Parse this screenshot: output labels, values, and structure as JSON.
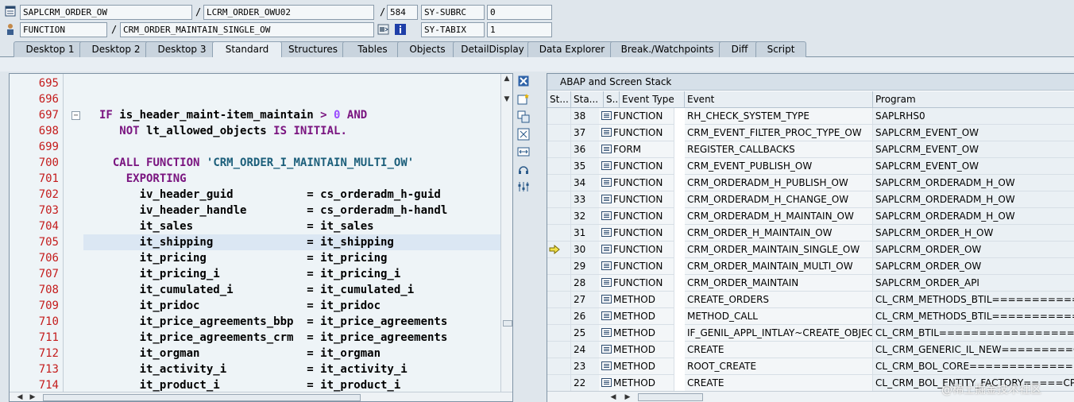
{
  "header": {
    "program": "SAPLCRM_ORDER_OW",
    "include": "LCRM_ORDER_OWU02",
    "line": "584",
    "sy_subrc_label": "SY-SUBRC",
    "sy_subrc_value": "0",
    "event_type": "FUNCTION",
    "event_name": "CRM_ORDER_MAINTAIN_SINGLE_OW",
    "sy_tabix_label": "SY-TABIX",
    "sy_tabix_value": "1",
    "separator": "/"
  },
  "tabs": [
    {
      "label": "Desktop 1"
    },
    {
      "label": "Desktop 2"
    },
    {
      "label": "Desktop 3"
    },
    {
      "label": "Standard"
    },
    {
      "label": "Structures"
    },
    {
      "label": "Tables"
    },
    {
      "label": "Objects"
    },
    {
      "label": "DetailDisplay"
    },
    {
      "label": "Data Explorer"
    },
    {
      "label": "Break./Watchpoints"
    },
    {
      "label": "Diff"
    },
    {
      "label": "Script"
    }
  ],
  "active_tab": "Standard",
  "code": {
    "lines": [
      {
        "num": "695",
        "text": ""
      },
      {
        "num": "696",
        "text": ""
      },
      {
        "num": "697",
        "text": "IF is_header_maint-item_maintain > 0 AND"
      },
      {
        "num": "698",
        "text": "   NOT lt_allowed_objects IS INITIAL."
      },
      {
        "num": "699",
        "text": ""
      },
      {
        "num": "700",
        "text": "  CALL FUNCTION 'CRM_ORDER_I_MAINTAIN_MULTI_OW'"
      },
      {
        "num": "701",
        "text": "    EXPORTING"
      },
      {
        "num": "702",
        "text": "      iv_header_guid           = cs_orderadm_h-guid"
      },
      {
        "num": "703",
        "text": "      iv_header_handle         = cs_orderadm_h-handl"
      },
      {
        "num": "704",
        "text": "      it_sales                 = it_sales"
      },
      {
        "num": "705",
        "text": "      it_shipping              = it_shipping"
      },
      {
        "num": "706",
        "text": "      it_pricing               = it_pricing"
      },
      {
        "num": "707",
        "text": "      it_pricing_i             = it_pricing_i"
      },
      {
        "num": "708",
        "text": "      it_cumulated_i           = it_cumulated_i"
      },
      {
        "num": "709",
        "text": "      it_pridoc                = it_pridoc"
      },
      {
        "num": "710",
        "text": "      it_price_agreements_bbp  = it_price_agreements"
      },
      {
        "num": "711",
        "text": "      it_price_agreements_crm  = it_price_agreements"
      },
      {
        "num": "712",
        "text": "      it_orgman                = it_orgman"
      },
      {
        "num": "713",
        "text": "      it_activity_i            = it_activity_i"
      },
      {
        "num": "714",
        "text": "      it_product_i             = it_product_i"
      }
    ],
    "current_line": "705"
  },
  "stack": {
    "title": "ABAP and Screen Stack",
    "columns": [
      "St...",
      "Sta...",
      "S...",
      "Event Type",
      "Event",
      "Program"
    ],
    "rows": [
      {
        "level": "38",
        "type": "FUNCTION",
        "event": "RH_CHECK_SYSTEM_TYPE",
        "program": "SAPLRHS0"
      },
      {
        "level": "37",
        "type": "FUNCTION",
        "event": "CRM_EVENT_FILTER_PROC_TYPE_OW",
        "program": "SAPLCRM_EVENT_OW"
      },
      {
        "level": "36",
        "type": "FORM",
        "event": "REGISTER_CALLBACKS",
        "program": "SAPLCRM_EVENT_OW"
      },
      {
        "level": "35",
        "type": "FUNCTION",
        "event": "CRM_EVENT_PUBLISH_OW",
        "program": "SAPLCRM_EVENT_OW"
      },
      {
        "level": "34",
        "type": "FUNCTION",
        "event": "CRM_ORDERADM_H_PUBLISH_OW",
        "program": "SAPLCRM_ORDERADM_H_OW"
      },
      {
        "level": "33",
        "type": "FUNCTION",
        "event": "CRM_ORDERADM_H_CHANGE_OW",
        "program": "SAPLCRM_ORDERADM_H_OW"
      },
      {
        "level": "32",
        "type": "FUNCTION",
        "event": "CRM_ORDERADM_H_MAINTAIN_OW",
        "program": "SAPLCRM_ORDERADM_H_OW"
      },
      {
        "level": "31",
        "type": "FUNCTION",
        "event": "CRM_ORDER_H_MAINTAIN_OW",
        "program": "SAPLCRM_ORDER_H_OW"
      },
      {
        "level": "30",
        "type": "FUNCTION",
        "event": "CRM_ORDER_MAINTAIN_SINGLE_OW",
        "program": "SAPLCRM_ORDER_OW"
      },
      {
        "level": "29",
        "type": "FUNCTION",
        "event": "CRM_ORDER_MAINTAIN_MULTI_OW",
        "program": "SAPLCRM_ORDER_OW"
      },
      {
        "level": "28",
        "type": "FUNCTION",
        "event": "CRM_ORDER_MAINTAIN",
        "program": "SAPLCRM_ORDER_API"
      },
      {
        "level": "27",
        "type": "METHOD",
        "event": "CREATE_ORDERS",
        "program": "CL_CRM_METHODS_BTIL===========CP"
      },
      {
        "level": "26",
        "type": "METHOD",
        "event": "METHOD_CALL",
        "program": "CL_CRM_METHODS_BTIL===========CP"
      },
      {
        "level": "25",
        "type": "METHOD",
        "event": "IF_GENIL_APPL_INTLAY~CREATE_OBJEC...",
        "program": "CL_CRM_BTIL==================..."
      },
      {
        "level": "24",
        "type": "METHOD",
        "event": "CREATE",
        "program": "CL_CRM_GENERIC_IL_NEW=========CP"
      },
      {
        "level": "23",
        "type": "METHOD",
        "event": "ROOT_CREATE",
        "program": "CL_CRM_BOL_CORE===============..."
      },
      {
        "level": "22",
        "type": "METHOD",
        "event": "CREATE",
        "program": "CL_CRM_BOL_ENTITY_FACTORY=====CP"
      }
    ],
    "current_level": "30"
  },
  "watermark": "@稀土掘金技术社区",
  "icons": {
    "arrow": "current-position-arrow-icon",
    "event": "event-type-icon"
  },
  "colors": {
    "line_numbers": "#c41c1c",
    "keywords": "#7a1580",
    "highlight": "#dbe7f3"
  }
}
